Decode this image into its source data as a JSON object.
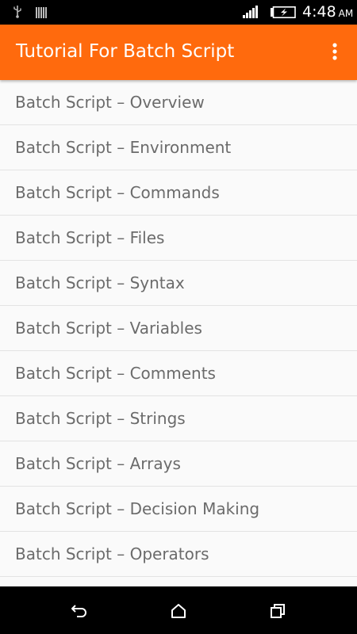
{
  "status_bar": {
    "time": "4:48",
    "ampm": "AM",
    "icons": [
      "usb-icon",
      "sim-bars-icon",
      "signal-icon",
      "battery-charging-icon"
    ]
  },
  "app_bar": {
    "title": "Tutorial For Batch Script",
    "overflow_icon": "more-vert-icon",
    "color": "#ff6a0d"
  },
  "list": {
    "items": [
      "Batch Script – Overview",
      "Batch Script – Environment",
      "Batch Script – Commands",
      "Batch Script – Files",
      "Batch Script – Syntax",
      "Batch Script – Variables",
      "Batch Script – Comments",
      "Batch Script – Strings",
      "Batch Script – Arrays",
      "Batch Script – Decision Making",
      "Batch Script – Operators"
    ]
  },
  "nav_bar": {
    "icons": [
      "back-icon",
      "home-icon",
      "recents-icon"
    ]
  }
}
